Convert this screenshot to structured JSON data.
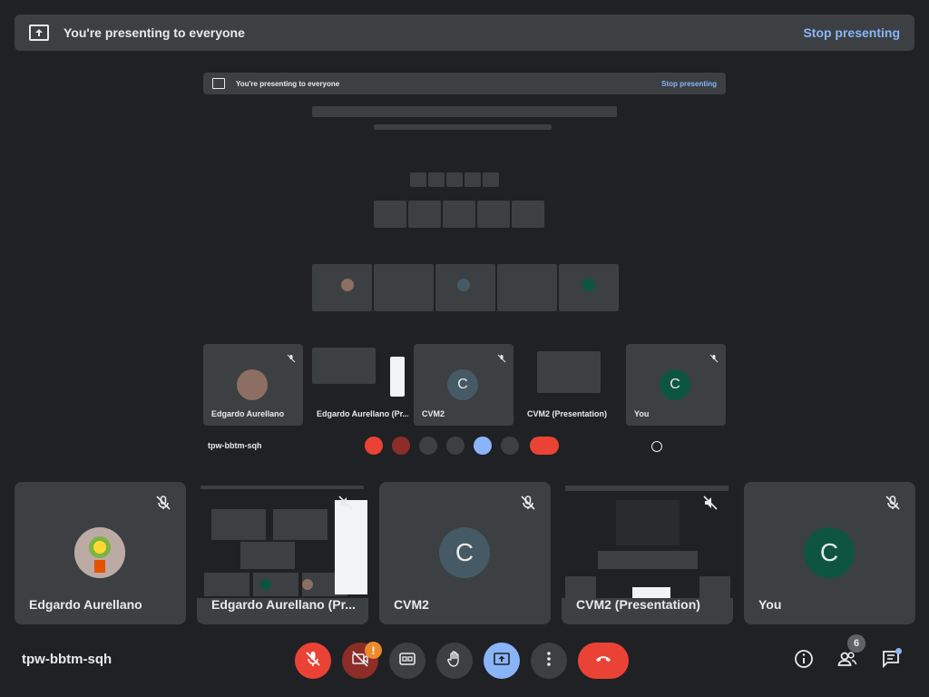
{
  "banner": {
    "text": "You're presenting to everyone",
    "stop_label": "Stop presenting"
  },
  "presentation": {
    "banner_text": "You're presenting to everyone",
    "stop_label": "Stop presenting",
    "meeting_code": "tpw-bbtm-sqh",
    "participant_count": "6",
    "tiles": [
      {
        "name": "Edgardo Aurellano"
      },
      {
        "name": "Edgardo Aurellano (Pr..."
      },
      {
        "name": "CVM2",
        "initial": "C"
      },
      {
        "name": "CVM2 (Presentation)"
      },
      {
        "name": "You",
        "initial": "C"
      }
    ]
  },
  "tiles": [
    {
      "name": "Edgardo Aurellano",
      "muted": true
    },
    {
      "name": "Edgardo Aurellano (Pr...",
      "muted": true
    },
    {
      "name": "CVM2",
      "initial": "C",
      "muted": true,
      "avatar_color": "#455a64"
    },
    {
      "name": "CVM2 (Presentation)",
      "muted": true
    },
    {
      "name": "You",
      "initial": "C",
      "muted": true,
      "avatar_color": "#0d5540"
    }
  ],
  "controls": {
    "meeting_code": "tpw-bbtm-sqh",
    "camera_alert": "!",
    "participant_count": "6",
    "mic_color": "#ea4335",
    "camera_color": "#8c2d27",
    "present_color": "#8ab4f8",
    "end_color": "#ea4335"
  },
  "icons": [
    "present-icon",
    "mic-off-icon",
    "camera-off-icon",
    "captions-icon",
    "raise-hand-icon",
    "present-now-icon",
    "more-options-icon",
    "end-call-icon",
    "info-icon",
    "people-icon",
    "chat-icon"
  ]
}
